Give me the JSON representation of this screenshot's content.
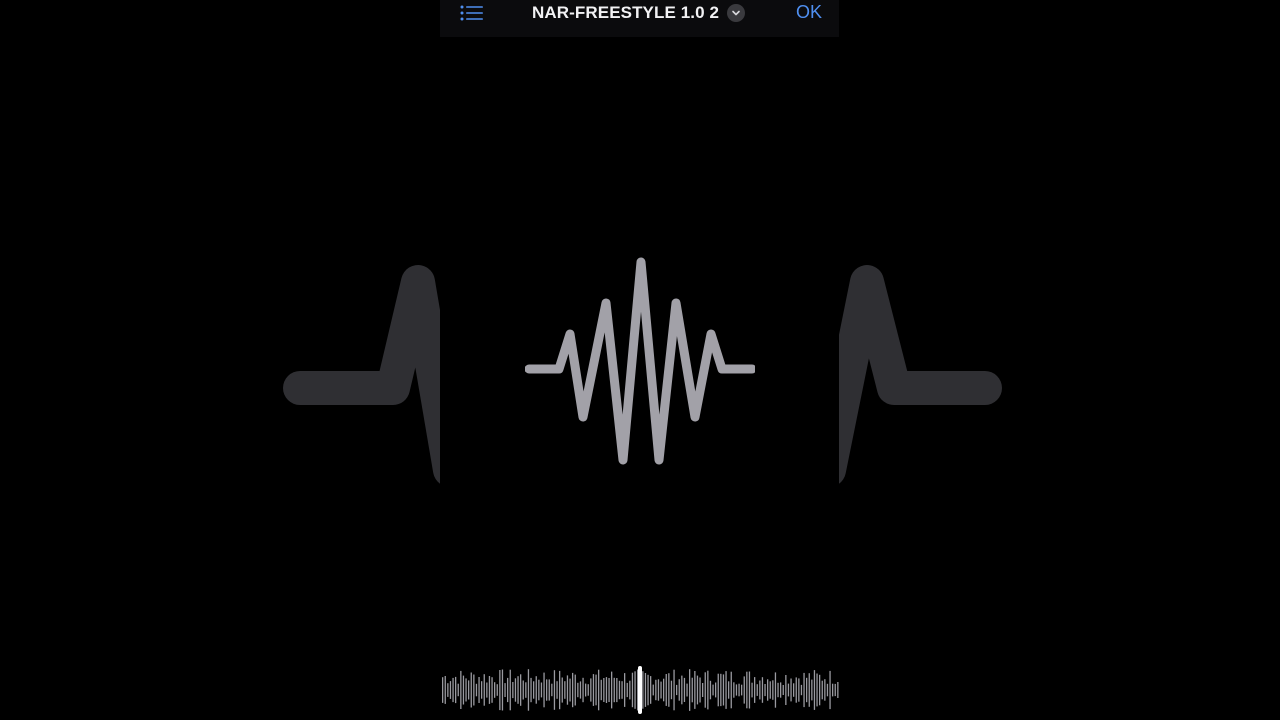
{
  "app": {
    "title": "NAR-FREESTYLE 1.0 2",
    "confirm_label": "OK"
  },
  "icons": {
    "list": "list-icon",
    "chevron": "chevron-down-icon",
    "waveform": "waveform-icon"
  },
  "colors": {
    "background": "#000000",
    "accent": "#4f8ff0",
    "waveform": "#a2a1a8",
    "ghost_waveform": "#2f2f33"
  },
  "scrubber": {
    "playhead_position": 0.5
  }
}
